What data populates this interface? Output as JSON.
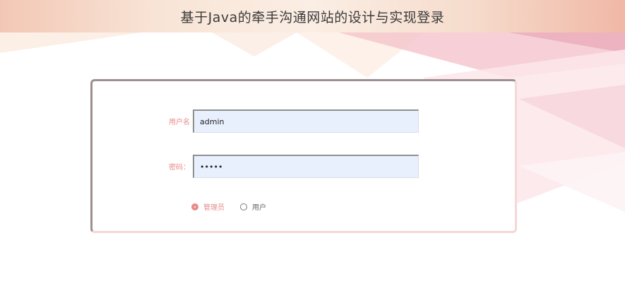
{
  "header": {
    "title": "基于Java的牵手沟通网站的设计与实现登录"
  },
  "form": {
    "username_label": "用户名",
    "username_value": "admin",
    "password_label": "密码：",
    "password_value": "•••••",
    "roles": [
      {
        "label": "管理员",
        "checked": true
      },
      {
        "label": "用户",
        "checked": false
      }
    ]
  },
  "colors": {
    "accent": "#e98a8a",
    "input_bg": "#e8f0fd",
    "header_band": "#f7dcc9"
  }
}
